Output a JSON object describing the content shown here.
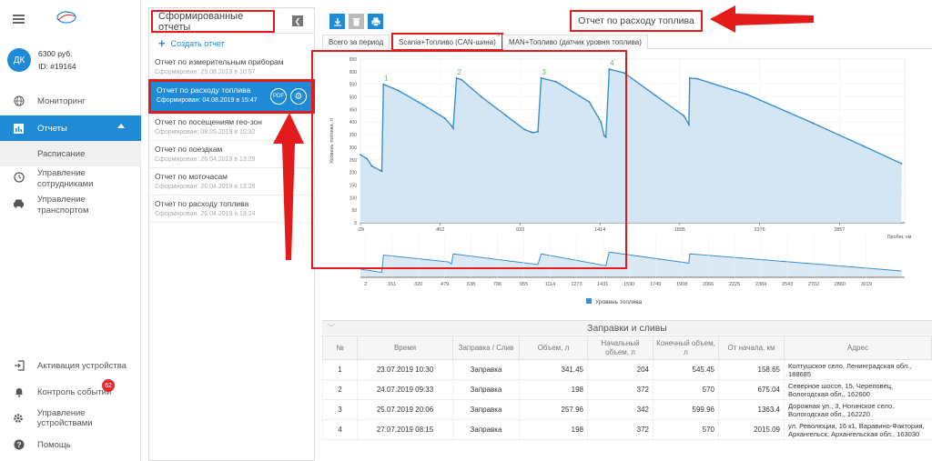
{
  "user": {
    "initials": "ДК",
    "balance": "6300 руб.",
    "id": "ID: #19164"
  },
  "nav": {
    "monitoring": "Мониторинг",
    "reports": "Отчеты",
    "schedule": "Расписание",
    "staff": "Управление сотрудниками",
    "transport": "Управление транспортом",
    "activation": "Активация устройства",
    "events": "Контроль событий",
    "events_badge": "62",
    "devices": "Управление устройствами",
    "help": "Помощь"
  },
  "reports_panel": {
    "title": "Сформированные отчеты",
    "create": "Создать отчет",
    "items": [
      {
        "title": "Отчет по измерительным приборам",
        "date": "Сформирован: 29.08.2019 в 10:57"
      },
      {
        "title": "Отчет по расходу топлива",
        "date": "Сформирован: 04.08.2019 в 15:47"
      },
      {
        "title": "Отчет по посещениям гео-зон",
        "date": "Сформирован: 08.05.2019 в 10:32"
      },
      {
        "title": "Отчет по поездкам",
        "date": "Сформирован: 26.04.2019 в 13:29"
      },
      {
        "title": "Отчет по моточасам",
        "date": "Сформирован: 26.04.2019 в 13:26"
      },
      {
        "title": "Отчет по расходу топлива",
        "date": "Сформирован: 26.04.2019 в 13:24"
      }
    ],
    "pdf_label": "PDF"
  },
  "main": {
    "title": "Отчет по расходу топлива",
    "tabs": [
      "Всего за период",
      "Scania+Топливо (CAN-шина)",
      "MAN+Топливо (датчик уровня топлива)"
    ],
    "tab_close": "×"
  },
  "chart_data": [
    {
      "type": "area",
      "ylabel": "Уровень топлива, л",
      "xlabel": "Пробег, км",
      "ylim": [
        0,
        650
      ],
      "yticks": [
        0,
        50,
        100,
        150,
        200,
        250,
        300,
        350,
        400,
        450,
        500,
        550,
        600,
        650
      ],
      "xticks": [
        "-29",
        "452",
        "933",
        "1414",
        "1895",
        "2376",
        "2857"
      ],
      "xlim": [
        -29,
        3250
      ],
      "annotations": [
        "1",
        "2",
        "3",
        "4"
      ],
      "series": [
        {
          "name": "Уровень топлива",
          "x": [
            -29,
            10,
            40,
            90,
            100,
            110,
            200,
            350,
            480,
            520,
            530,
            550,
            580,
            700,
            850,
            960,
            1000,
            1010,
            1040,
            1060,
            1150,
            1350,
            1420,
            1440,
            1450,
            1470,
            1560,
            1750,
            1920,
            1950,
            1955,
            2000,
            2300,
            2700,
            3000,
            3230
          ],
          "y": [
            270,
            255,
            225,
            208,
            205,
            550,
            525,
            468,
            415,
            385,
            375,
            575,
            568,
            500,
            425,
            370,
            360,
            358,
            362,
            575,
            560,
            480,
            400,
            345,
            340,
            610,
            595,
            505,
            425,
            390,
            575,
            572,
            510,
            395,
            305,
            235
          ]
        }
      ]
    },
    {
      "type": "area",
      "xticks": [
        "2",
        "161",
        "320",
        "479",
        "638",
        "796",
        "955",
        "1114",
        "1273",
        "1431",
        "1590",
        "1749",
        "1908",
        "2066",
        "2225",
        "2384",
        "2543",
        "2702",
        "2860",
        "3019"
      ],
      "xlim": [
        -29,
        3250
      ],
      "legend": [
        "Уровень топлива"
      ],
      "series": [
        {
          "name": "Уровень топлива",
          "x": [
            -29,
            100,
            110,
            500,
            520,
            530,
            1040,
            1060,
            1450,
            1470,
            1950,
            1955,
            3230
          ],
          "y": [
            270,
            205,
            550,
            415,
            375,
            575,
            362,
            575,
            340,
            610,
            390,
            575,
            235
          ]
        }
      ]
    }
  ],
  "table": {
    "title": "Заправки и сливы",
    "headers": [
      "№",
      "Время",
      "Заправка / Слив",
      "Объем, л",
      "Начальный объем, л",
      "Конечный объем, л",
      "От начала, км",
      "Адрес"
    ],
    "rows": [
      [
        "1",
        "23.07.2019 10:30",
        "Заправка",
        "341.45",
        "204",
        "545.45",
        "158.65",
        "Колтушское село, Ленинградская обл., 188685"
      ],
      [
        "2",
        "24.07.2019 09:33",
        "Заправка",
        "198",
        "372",
        "570",
        "675.04",
        "Северное шоссе, 15, Череповец, Вологодская обл., 162600"
      ],
      [
        "3",
        "25.07.2019 20:06",
        "Заправка",
        "257.96",
        "342",
        "599.96",
        "1363.4",
        "Дорожная ул., 3, Ногинское село, Вологодская обл., 162220"
      ],
      [
        "4",
        "27.07.2019 08:15",
        "Заправка",
        "198",
        "372",
        "570",
        "2015.09",
        "ул. Революции, 16 к1, Варавино-Фактория, Архангельск, Архангельская обл., 163030"
      ]
    ]
  }
}
